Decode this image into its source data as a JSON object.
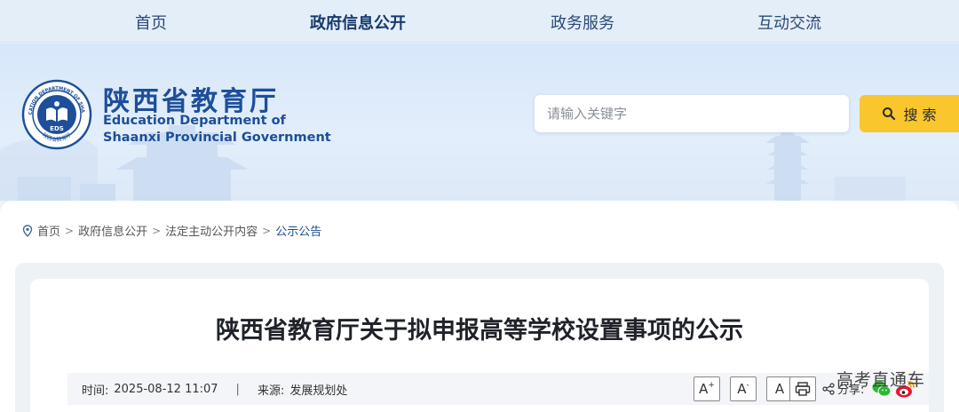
{
  "nav": {
    "items": [
      {
        "label": "首页"
      },
      {
        "label": "政府信息公开"
      },
      {
        "label": "政务服务"
      },
      {
        "label": "互动交流"
      }
    ],
    "active_index": 1
  },
  "logo": {
    "cn_name": "陕西省教育厅",
    "en_line1": "Education Department of",
    "en_line2": "Shaanxi Provincial Government",
    "emblem_text": "EDS",
    "emblem_ring_text": "EDUCATION DEPARTMENT OF SHAANXI",
    "emblem_bottom_text": "陕西省教育厅"
  },
  "search": {
    "placeholder": "请输入关键字",
    "button_label": "搜 索"
  },
  "breadcrumb": {
    "items": [
      "首页",
      "政府信息公开",
      "法定主动公开内容"
    ],
    "current": "公示公告",
    "separator": ">"
  },
  "article": {
    "title": "陕西省教育厅关于拟申报高等学校设置事项的公示",
    "time_label": "时间:",
    "time_value": "2025-08-12 11:07",
    "divider": "|",
    "source_label": "来源:",
    "source_value": "发展规划处"
  },
  "tools": {
    "font_large": "A",
    "font_large_sup": "+",
    "font_small": "A",
    "font_small_sup": "-",
    "font_default": "A",
    "share_label": "分享:"
  },
  "watermark": "高考直通车",
  "colors": {
    "brand_blue": "#1d4f9a",
    "search_button": "#f9c62b",
    "nav_bg": "#e4eef9",
    "breadcrumb_current": "#1b4f96"
  }
}
